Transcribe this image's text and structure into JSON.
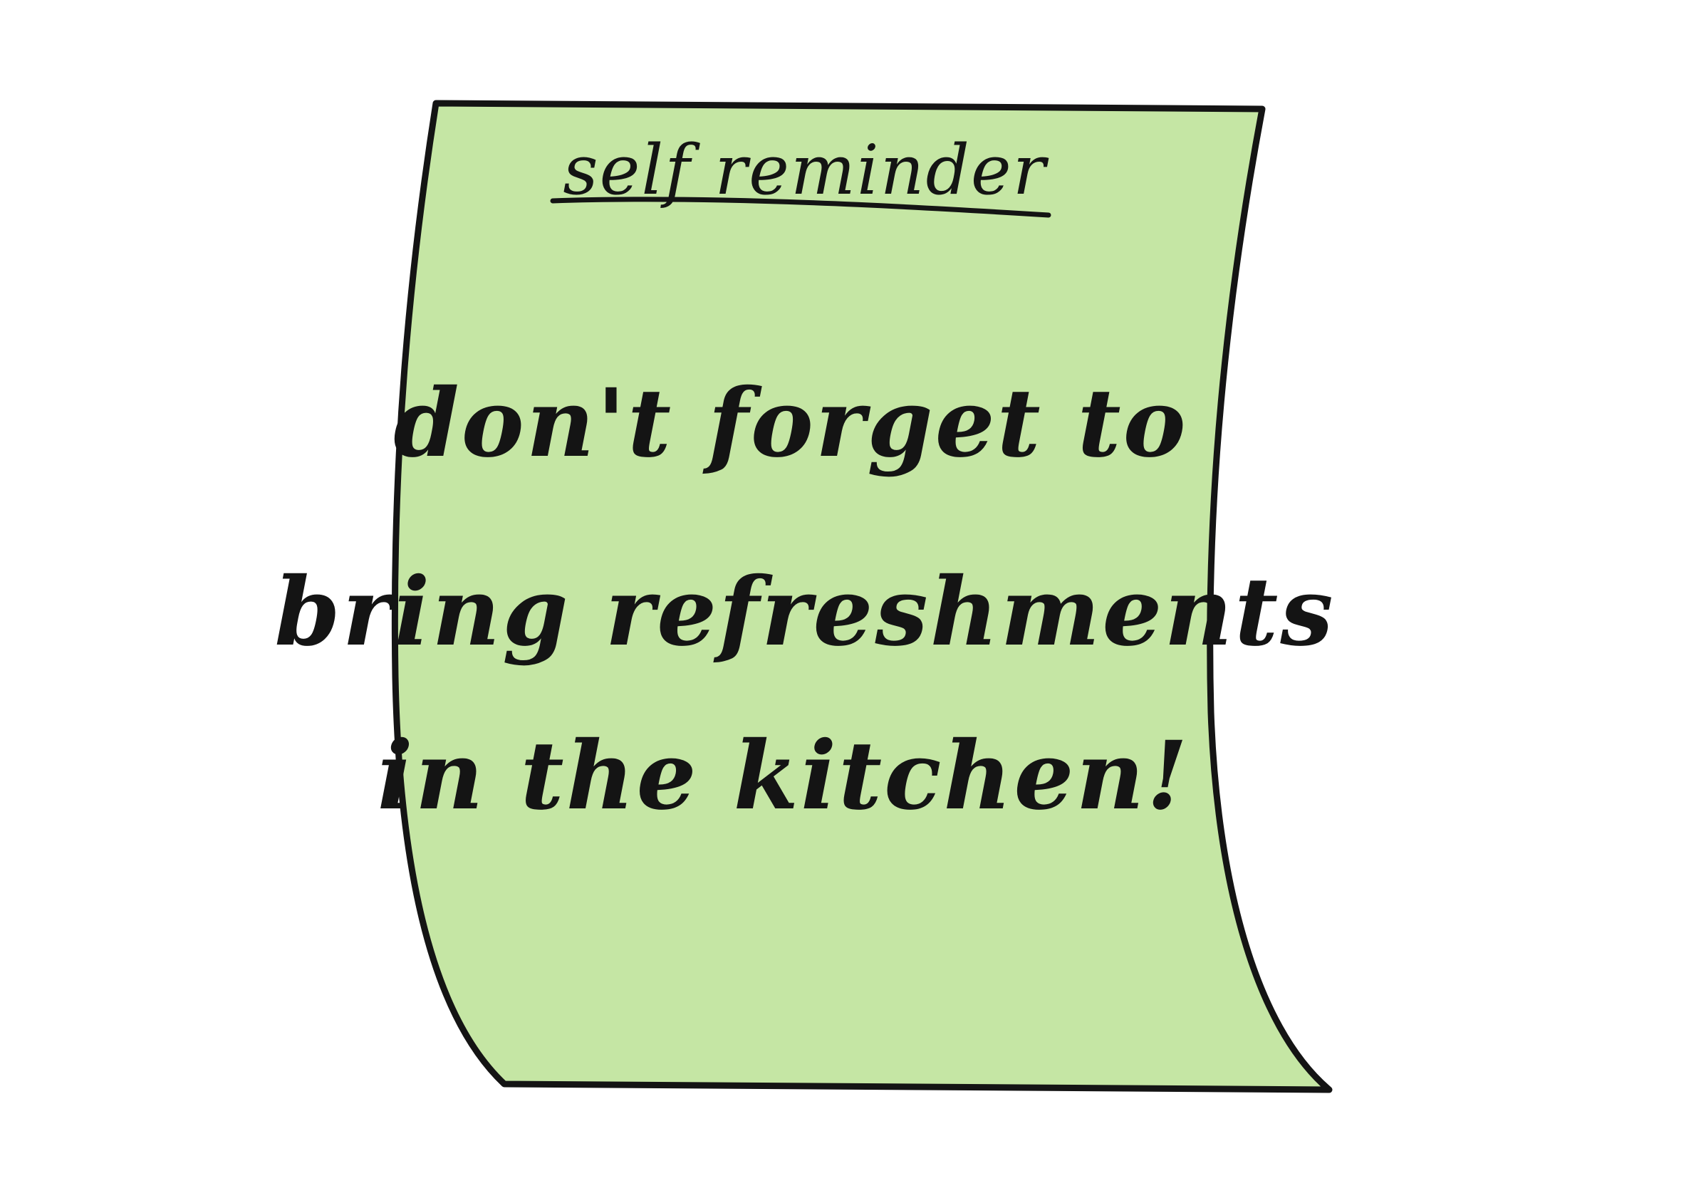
{
  "note": {
    "title": "self reminder",
    "lines": [
      "don't forget to",
      "bring refreshments",
      "in the kitchen!"
    ],
    "fill_color": "#c5e6a4",
    "ink_color": "#141414"
  }
}
